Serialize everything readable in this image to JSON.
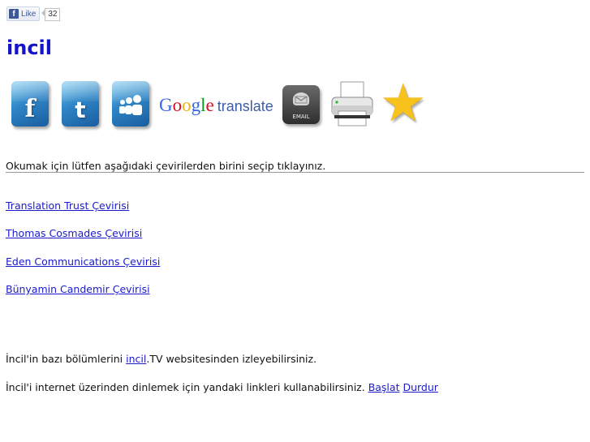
{
  "fb": {
    "like_label": "Like",
    "like_count": "32"
  },
  "page": {
    "title": "incil"
  },
  "share": {
    "google_word": [
      "G",
      "o",
      "o",
      "g",
      "l",
      "e"
    ],
    "google_colors": [
      "#3369e8",
      "#d50f25",
      "#eeb211",
      "#3369e8",
      "#009925",
      "#d50f25"
    ],
    "translate_word": "translate",
    "email_label": "EMAIL",
    "icons": [
      "facebook-icon",
      "twitter-icon",
      "myspace-icon",
      "google-translate-icon",
      "email-icon",
      "printer-icon",
      "favorite-star-icon"
    ]
  },
  "intro": "Okumak için lütfen aşağıdaki çevirilerden birini seçip tıklayınız.",
  "translations": [
    "Translation Trust Çevirisi",
    "Thomas Cosmades Çevirisi",
    "Eden Communications Çevirisi",
    "Bünyamin Candemir Çevirisi"
  ],
  "watch": {
    "before": "İncil'in bazı bölümlerini ",
    "link": "incil",
    "after": ".TV websitesinden izleyebilirsiniz."
  },
  "listen": {
    "text": "İncil'i internet üzerinden dinlemek için yandaki linkleri kullanabilirsiniz. ",
    "start": "Başlat",
    "stop": "Durdur"
  },
  "colors": {
    "title": "#1414cc",
    "link": "#1a1acc",
    "fb_blue": "#3b5998",
    "star": "#f6c21b"
  }
}
